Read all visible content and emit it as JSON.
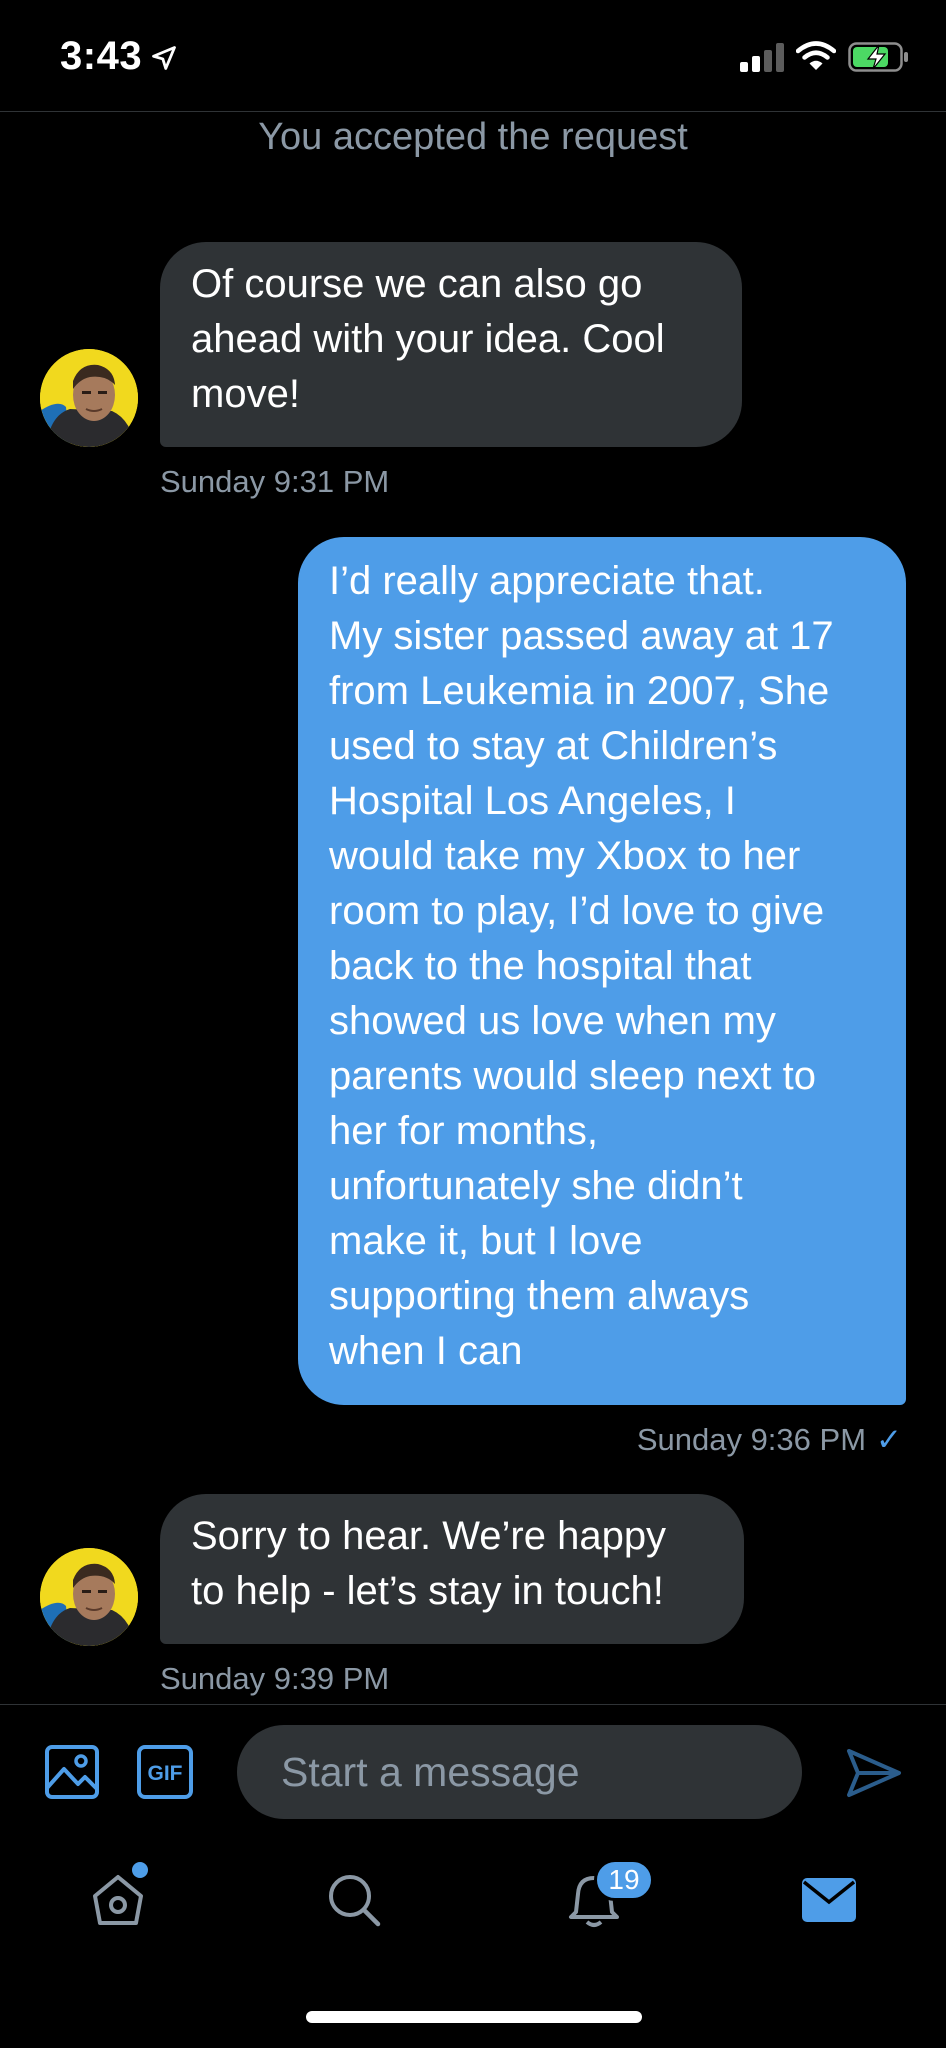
{
  "status_bar": {
    "time": "3:43",
    "icons": [
      "location-arrow-icon",
      "cellular-signal-icon",
      "wifi-icon",
      "battery-charging-icon"
    ]
  },
  "conversation": {
    "system_note": "You accepted the request",
    "messages": [
      {
        "direction": "incoming",
        "text": "Of course we can also go\nahead with your idea. Cool\nmove!",
        "timestamp": "Sunday 9:31 PM"
      },
      {
        "direction": "outgoing",
        "text": "I’d really appreciate that.\nMy sister passed away at 17\nfrom Leukemia in 2007, She\nused to stay at Children’s\nHospital Los Angeles, I\nwould take my Xbox to her\nroom to play, I’d love to give\nback to the hospital that\nshowed us love when my\nparents would sleep next to\nher for months,\nunfortunately she didn’t\nmake it, but I love\nsupporting them always\nwhen I can",
        "timestamp": "Sunday 9:36 PM",
        "read_mark": "✓"
      },
      {
        "direction": "incoming",
        "text": "Sorry to hear. We’re happy\nto help - let’s stay in touch!",
        "timestamp": "Sunday 9:39 PM"
      }
    ]
  },
  "composer": {
    "placeholder": "Start a message",
    "gif_label": "GIF",
    "icons": [
      "image-icon",
      "gif-icon",
      "send-icon"
    ]
  },
  "tab_bar": {
    "items": [
      "home",
      "search",
      "notifications",
      "messages"
    ],
    "notifications_badge": "19",
    "active": "messages"
  },
  "colors": {
    "background": "#000000",
    "accent": "#4e9de8",
    "incoming_bubble": "#2f3336",
    "secondary_text": "#8b98a5"
  }
}
